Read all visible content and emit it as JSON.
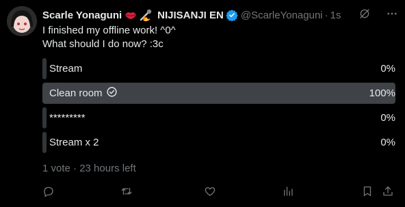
{
  "author": {
    "display_name": "Scarle Yonaguni",
    "affiliation": "NIJISANJI EN",
    "handle": "@ScarleYonaguni",
    "separator": "·",
    "time": "1s"
  },
  "tweet": {
    "line1": "I finished my offline work! ^0^",
    "line2": "What should I do now? :3c"
  },
  "poll": {
    "options": [
      {
        "label": "Stream",
        "percent": "0%",
        "fill": 0.0
      },
      {
        "label": "Clean room",
        "percent": "100%",
        "fill": 1.0,
        "selected": true
      },
      {
        "label": "*********",
        "percent": "0%",
        "fill": 0.0
      },
      {
        "label": "Stream x 2",
        "percent": "0%",
        "fill": 0.0
      }
    ],
    "meta": "1 vote · 23 hours left"
  },
  "colors": {
    "background": "#000000",
    "text": "#e7e9ea",
    "muted": "#71767b",
    "bar": "#333639",
    "verified": "#1d9bf0"
  },
  "icons": [
    "grok-icon",
    "more-icon",
    "reply-icon",
    "retweet-icon",
    "like-icon",
    "views-icon",
    "bookmark-icon",
    "share-icon"
  ]
}
